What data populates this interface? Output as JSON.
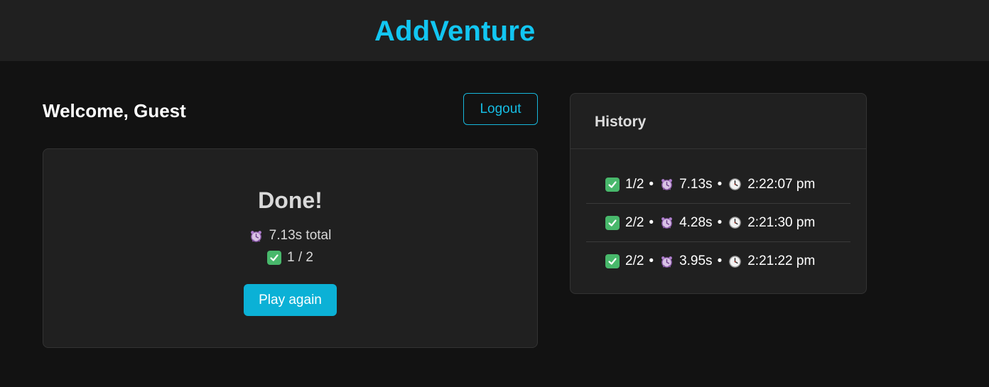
{
  "app": {
    "title": "AddVenture"
  },
  "header": {
    "welcome": "Welcome, Guest",
    "logout_label": "Logout"
  },
  "result": {
    "title": "Done!",
    "total_time": "7.13s total",
    "score": "1 / 2",
    "play_again_label": "Play again"
  },
  "history": {
    "title": "History",
    "separator": "•",
    "entries": [
      {
        "score": "1/2",
        "time": "7.13s",
        "clock": "2:22:07 pm"
      },
      {
        "score": "2/2",
        "time": "4.28s",
        "clock": "2:21:30 pm"
      },
      {
        "score": "2/2",
        "time": "3.95s",
        "clock": "2:21:22 pm"
      }
    ]
  },
  "icons": {
    "check": "check-mark-icon",
    "alarm": "alarm-clock-icon",
    "clock": "clock-icon"
  },
  "colors": {
    "accent": "#12c6f2",
    "button": "#0bb1d6",
    "check": "#48b86b",
    "background": "#121212",
    "surface": "#202020"
  }
}
